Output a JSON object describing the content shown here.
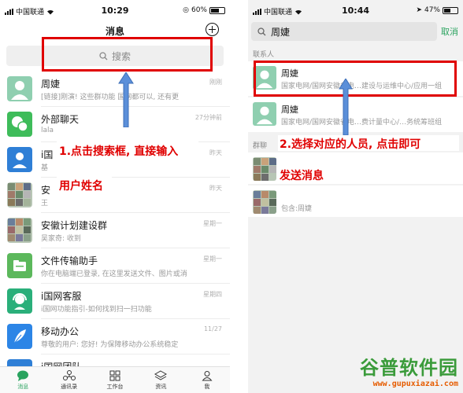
{
  "left": {
    "status": {
      "carrier": "中国联通",
      "time": "10:29",
      "battery": "60%",
      "battery_level": 0.6
    },
    "header_title": "消息",
    "search_placeholder": "搜索",
    "chats": [
      {
        "name": "周婕",
        "preview": "[链接]刚演! 这些群功能 国网都可以, 还有更",
        "time": "刚刚",
        "avatar": "person-avatar-icon"
      },
      {
        "name": "外部聊天",
        "preview": "lala",
        "time": "27分钟前",
        "avatar": "chat-bubble-icon"
      },
      {
        "name": "i国",
        "preview": "基",
        "time": "昨天",
        "avatar": "user-service-icon"
      },
      {
        "name": "安",
        "preview": "王",
        "time": "昨天",
        "avatar": "group-avatar-grid"
      },
      {
        "name": "安徽计划建设群",
        "preview": "吴家奇: 收到",
        "time": "星期一",
        "avatar": "group-avatar-grid"
      },
      {
        "name": "文件传输助手",
        "preview": "你在电脑端已登录, 在这里发送文件、图片或消",
        "time": "星期一",
        "avatar": "folder-icon"
      },
      {
        "name": "i国网客服",
        "preview": "i国网功能指引-如何找到扫一扫功能",
        "time": "星期四",
        "avatar": "customer-service-icon"
      },
      {
        "name": "移动办公",
        "preview": "尊敬的用户: 您好! 为保障移动办公系统稳定",
        "time": "11/27",
        "avatar": "feather-icon"
      },
      {
        "name": "i国网团队",
        "preview": "",
        "time": "",
        "avatar": "team-icon"
      }
    ],
    "annotation_line1": "1.点击搜索框, 直接输入",
    "annotation_line2": "用户姓名",
    "tabs": [
      {
        "label": "消息",
        "icon": "message-icon",
        "active": true
      },
      {
        "label": "通讯录",
        "icon": "contacts-icon",
        "active": false
      },
      {
        "label": "工作台",
        "icon": "workbench-icon",
        "active": false
      },
      {
        "label": "资讯",
        "icon": "news-icon",
        "active": false
      },
      {
        "label": "我",
        "icon": "me-icon",
        "active": false
      }
    ]
  },
  "right": {
    "status": {
      "carrier": "中国联通",
      "time": "10:44",
      "battery": "47%",
      "battery_level": 0.47
    },
    "search_value": "周婕",
    "cancel": "取消",
    "section_contacts": "联系人",
    "contacts": [
      {
        "name": "周婕",
        "sub": "国家电网/国网安徽省电…建设与运维中心/应用一组"
      },
      {
        "name": "周婕",
        "sub": "国家电网/国网安徽省电…费计量中心/…务统筹班组"
      }
    ],
    "section_groups": "群聊",
    "group_match_label": "包含:周婕",
    "annotation_line1": "2.选择对应的人员, 点击即可",
    "annotation_line2": "发送消息"
  },
  "watermark": {
    "title": "谷普软件园",
    "url": "www.gupuxiazai.com"
  },
  "colors": {
    "accent": "#2aa35f",
    "annotation": "#e00000",
    "arrow": "#5b8fd9"
  }
}
